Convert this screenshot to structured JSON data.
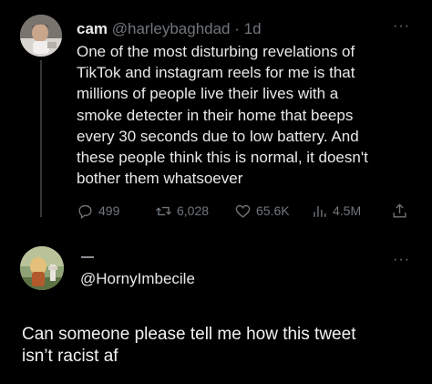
{
  "tweet": {
    "author": {
      "display_name": "cam",
      "handle_and_time": "@harleybaghdad · 1d"
    },
    "more_label": "···",
    "body_lines": [
      "One of the most disturbing revelations of",
      "TikTok and instagram reels for me is that",
      "millions of people live their lives with a",
      "smoke detecter in their home that beeps",
      "every 30 seconds due to low battery. And",
      "these people think this is normal, it doesn't",
      "bother them whatsoever"
    ],
    "stats": {
      "replies": "499",
      "retweets": "6,028",
      "likes": "65.6K",
      "views": "4.5M"
    },
    "icons": [
      "reply-icon",
      "retweet-icon",
      "like-icon",
      "views-icon",
      "share-icon"
    ]
  },
  "reply_tweet": {
    "handle": "@HornyImbecile",
    "more_label": "···"
  },
  "caption": {
    "lines": [
      "Can someone please tell me how this tweet",
      "isn’t racist af"
    ]
  },
  "colors": {
    "background": "#000000",
    "text": "#e7e9ea",
    "muted": "#71767b"
  }
}
